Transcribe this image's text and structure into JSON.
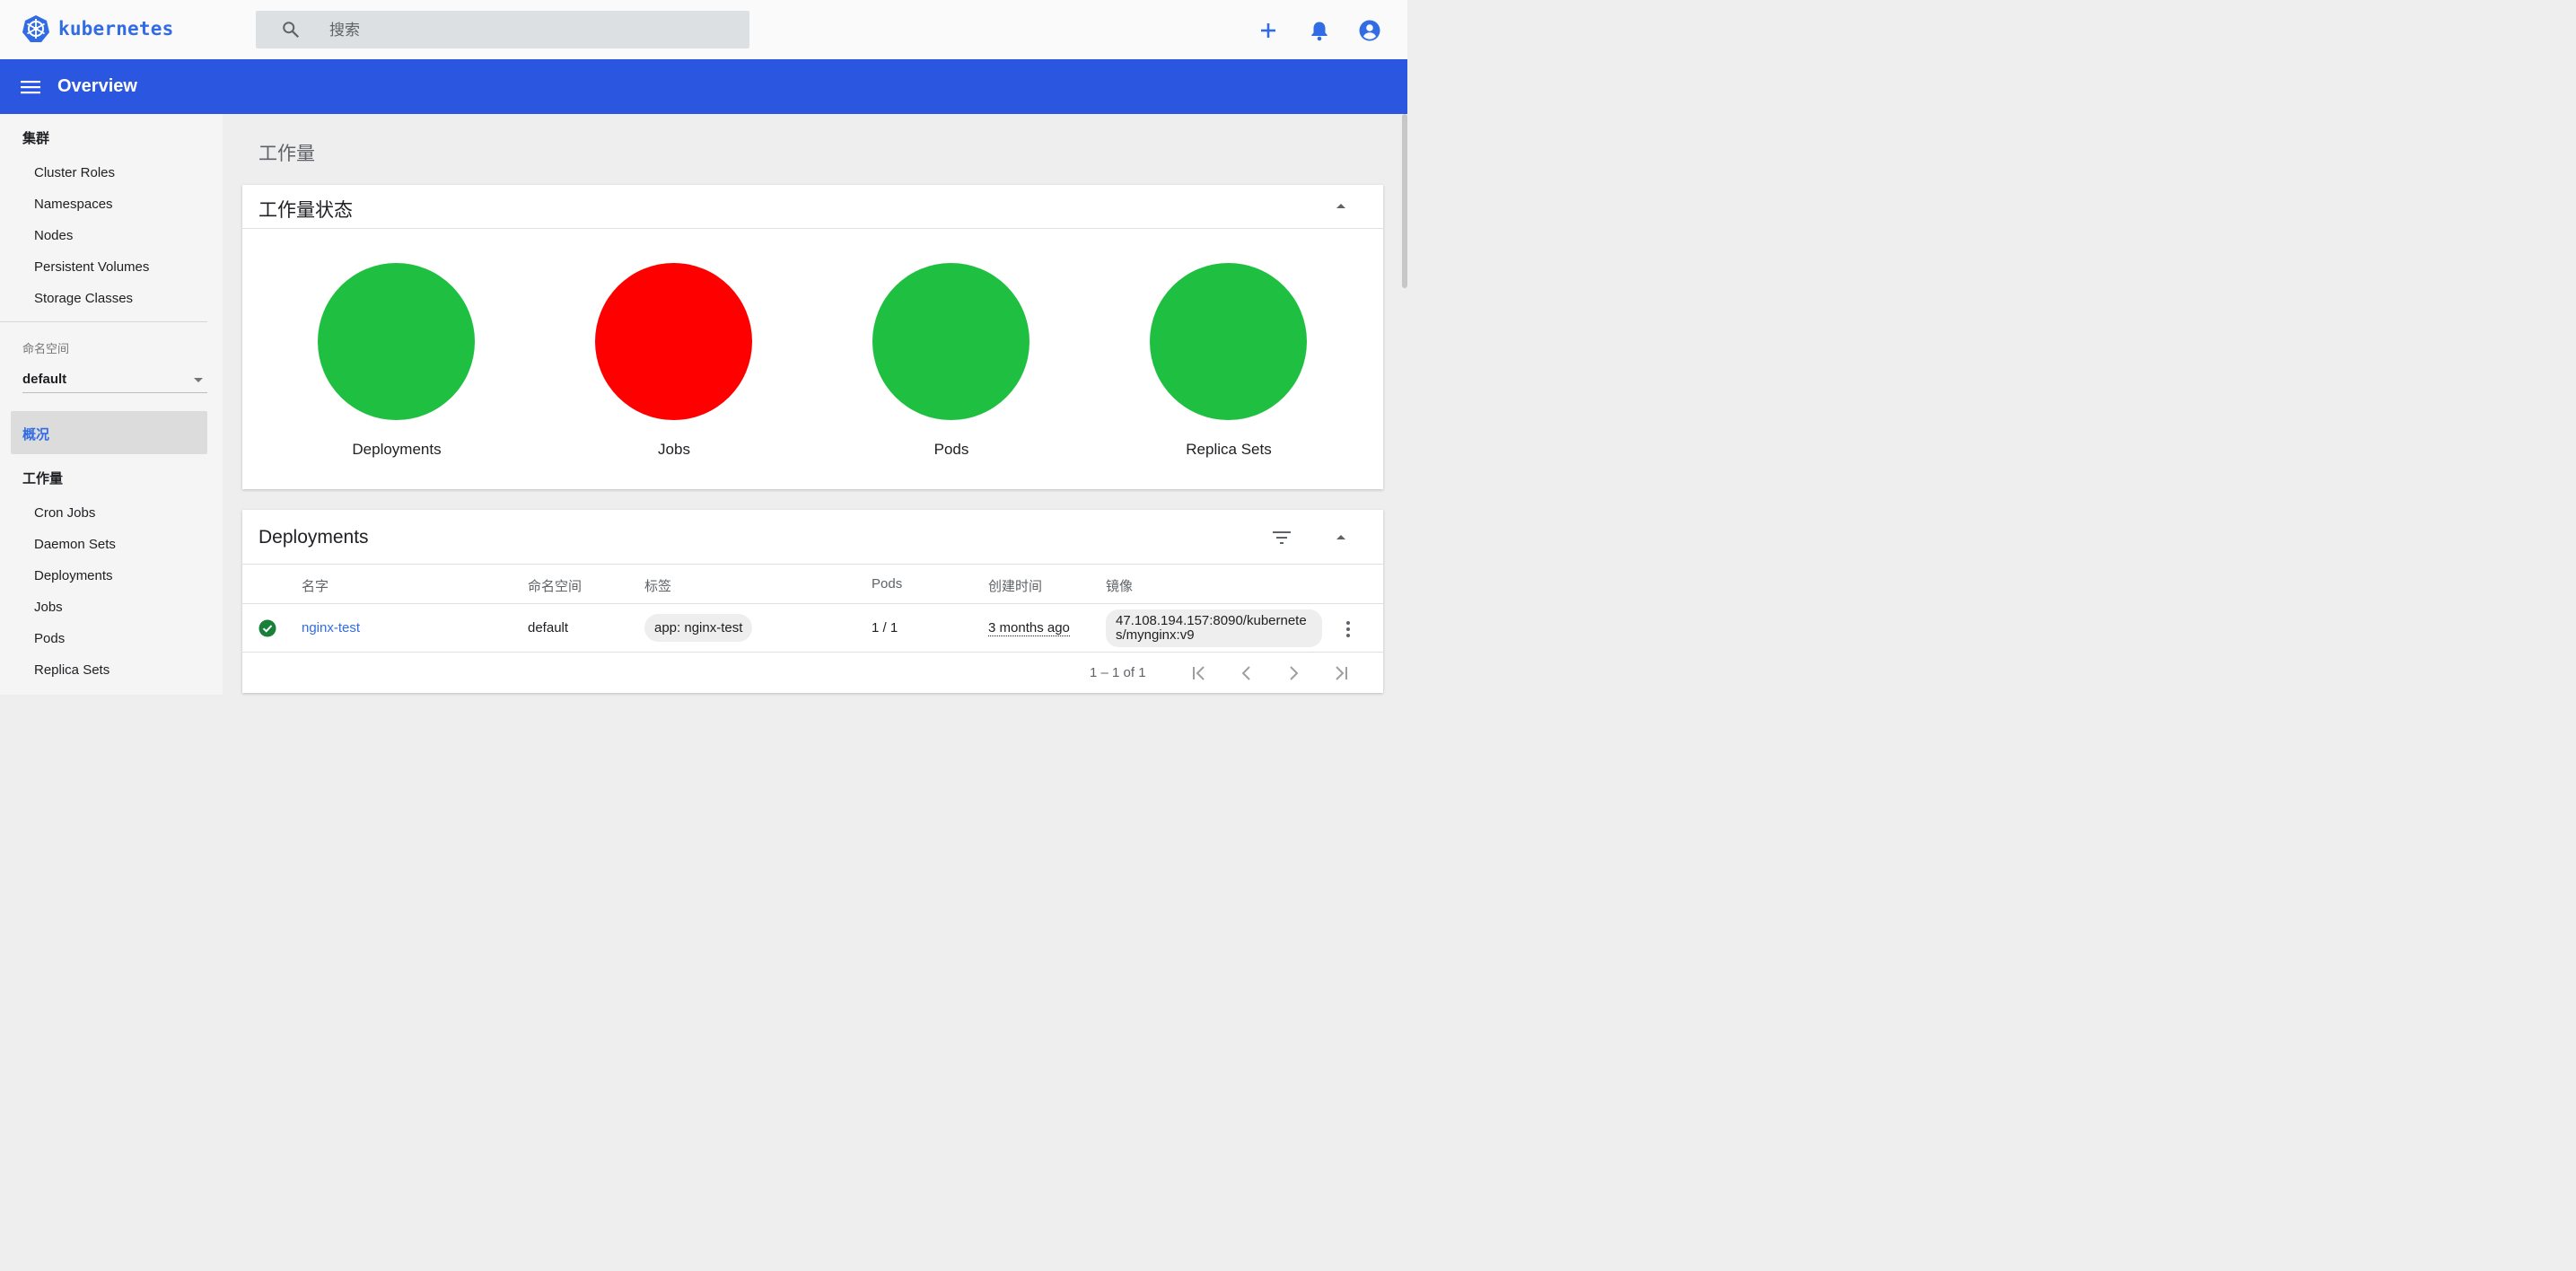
{
  "header": {
    "brand": "kubernetes",
    "search_placeholder": "搜索",
    "icons": [
      "add-icon",
      "notifications-icon",
      "account-icon"
    ]
  },
  "toolbar": {
    "title": "Overview"
  },
  "sidebar": {
    "cluster": {
      "heading": "集群",
      "items": [
        "Cluster Roles",
        "Namespaces",
        "Nodes",
        "Persistent Volumes",
        "Storage Classes"
      ]
    },
    "namespace": {
      "label": "命名空间",
      "value": "default"
    },
    "overview_label": "概况",
    "workloads": {
      "heading": "工作量",
      "items": [
        "Cron Jobs",
        "Daemon Sets",
        "Deployments",
        "Jobs",
        "Pods",
        "Replica Sets"
      ]
    }
  },
  "main": {
    "page_title": "工作量",
    "status_card": {
      "title": "工作量状态",
      "items": [
        {
          "label": "Deployments",
          "color": "#1fc041"
        },
        {
          "label": "Jobs",
          "color": "#ff0000"
        },
        {
          "label": "Pods",
          "color": "#1fc041"
        },
        {
          "label": "Replica Sets",
          "color": "#1fc041"
        }
      ]
    },
    "deployments_card": {
      "title": "Deployments",
      "columns": [
        "名字",
        "命名空间",
        "标签",
        "Pods",
        "创建时间",
        "镜像"
      ],
      "rows": [
        {
          "status": "success",
          "name": "nginx-test",
          "namespace": "default",
          "label": "app: nginx-test",
          "pods": "1 / 1",
          "created": "3 months ago",
          "image_line1": "47.108.194.157:8090/kubernete",
          "image_line2": "s/mynginx:v9"
        }
      ],
      "pager": "1 – 1 of 1"
    }
  },
  "colors": {
    "brand_blue": "#326ce5",
    "toolbar_blue": "#2a56e0",
    "ok_green": "#1fc041",
    "error_red": "#ff0000"
  }
}
